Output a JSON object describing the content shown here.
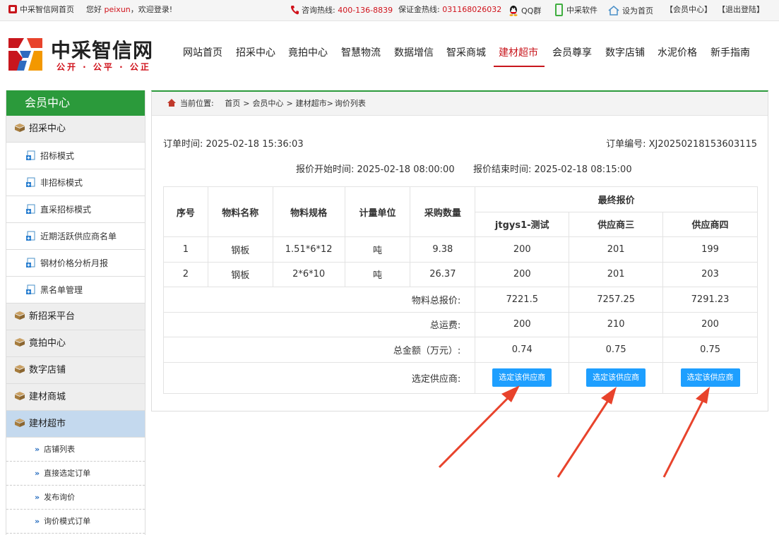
{
  "topbar": {
    "site_home": "中采智信网首页",
    "greeting_prefix": "您好",
    "username": "peixun",
    "greeting_suffix": "，欢迎登录!",
    "hotline_label": "咨询热线:",
    "hotline_number": "400-136-8839",
    "deposit_label": "保证金热线:",
    "deposit_number": "031168026032",
    "qq_group": "QQ群",
    "mobile_app": "中采软件",
    "set_home": "设为首页",
    "member_center": "【会员中心】",
    "logout": "【退出登陆】"
  },
  "logo": {
    "title": "中采智信网",
    "slogan": "公开 · 公平 · 公正"
  },
  "nav": [
    {
      "label": "网站首页"
    },
    {
      "label": "招采中心"
    },
    {
      "label": "竟拍中心"
    },
    {
      "label": "智慧物流"
    },
    {
      "label": "数据增信"
    },
    {
      "label": "智采商城"
    },
    {
      "label": "建材超市"
    },
    {
      "label": "会员尊享"
    },
    {
      "label": "数字店铺"
    },
    {
      "label": "水泥价格"
    },
    {
      "label": "新手指南"
    }
  ],
  "nav_active": "建材超市",
  "sidebar": {
    "title": "会员中心",
    "group1": {
      "label": "招采中心",
      "items": [
        {
          "label": "招标模式"
        },
        {
          "label": "非招标模式"
        },
        {
          "label": "直采招标模式"
        },
        {
          "label": "近期活跃供应商名单"
        },
        {
          "label": "钢材价格分析月报"
        },
        {
          "label": "黑名单管理"
        }
      ]
    },
    "groups": [
      {
        "label": "新招采平台"
      },
      {
        "label": "竟拍中心"
      },
      {
        "label": "数字店铺"
      },
      {
        "label": "建材商城"
      }
    ],
    "active_group": {
      "label": "建材超市",
      "items": [
        {
          "label": "店铺列表"
        },
        {
          "label": "直接选定订单"
        },
        {
          "label": "发布询价"
        },
        {
          "label": "询价模式订单"
        }
      ]
    }
  },
  "breadcrumb": {
    "prefix": "当前位置:",
    "items": [
      "首页",
      "会员中心",
      "建材超市",
      "询价列表"
    ]
  },
  "order": {
    "time_label": "订单时间:",
    "time_value": "2025-02-18 15:36:03",
    "no_label": "订单编号:",
    "no_value": "XJ20250218153603115",
    "quote_start_label": "报价开始时间:",
    "quote_start_value": "2025-02-18 08:00:00",
    "quote_end_label": "报价结束时间:",
    "quote_end_value": "2025-02-18 08:15:00"
  },
  "table": {
    "headers": [
      "序号",
      "物料名称",
      "物料规格",
      "计量单位",
      "采购数量"
    ],
    "final_quote_header": "最终报价",
    "suppliers": [
      "jtgys1-测试",
      "供应商三",
      "供应商四"
    ],
    "rows": [
      {
        "no": "1",
        "name": "钢板",
        "spec": "1.51*6*12",
        "unit": "吨",
        "qty": "9.38",
        "prices": [
          "200",
          "201",
          "199"
        ]
      },
      {
        "no": "2",
        "name": "钢板",
        "spec": "2*6*10",
        "unit": "吨",
        "qty": "26.37",
        "prices": [
          "200",
          "201",
          "203"
        ]
      }
    ],
    "total_material_label": "物料总报价:",
    "total_material": [
      "7221.5",
      "7257.25",
      "7291.23"
    ],
    "freight_label": "总运费:",
    "freight": [
      "200",
      "210",
      "200"
    ],
    "total_amount_label": "总金额（万元）:",
    "total_amount": [
      "0.74",
      "0.75",
      "0.75"
    ],
    "select_label": "选定供应商:",
    "select_button": "选定该供应商"
  },
  "colors": {
    "brand_red": "#c8161d",
    "sidebar_green": "#2b9a3b",
    "button_blue": "#1e9fff",
    "annotation_arrow": "#e8432c"
  }
}
